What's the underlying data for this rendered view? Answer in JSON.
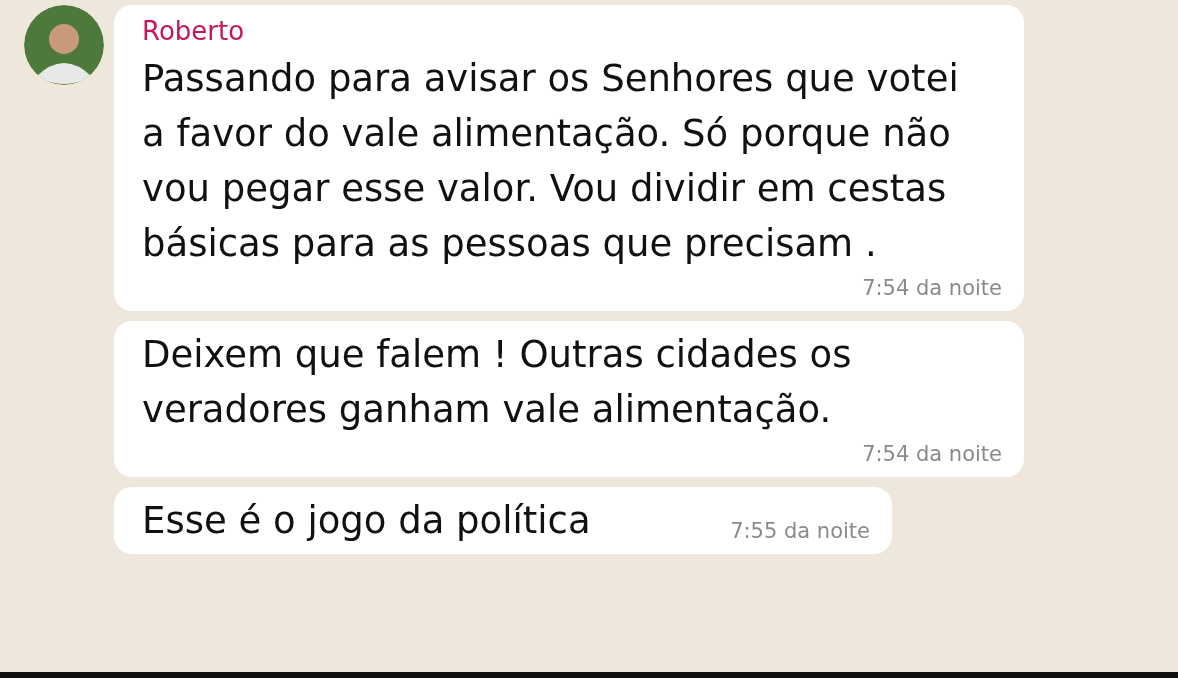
{
  "messages": [
    {
      "sender": "Roberto",
      "text": "Passando para avisar os Senhores que votei a favor do vale alimentação. Só porque não vou pegar esse valor. Vou dividir em cestas  básicas para as pessoas que precisam .",
      "time": "7:54 da noite"
    },
    {
      "text": "Deixem que falem ! Outras cidades os veradores ganham vale alimentação.",
      "time": "7:54 da noite"
    },
    {
      "text": "Esse é o jogo da política",
      "time": "7:55 da noite"
    }
  ]
}
